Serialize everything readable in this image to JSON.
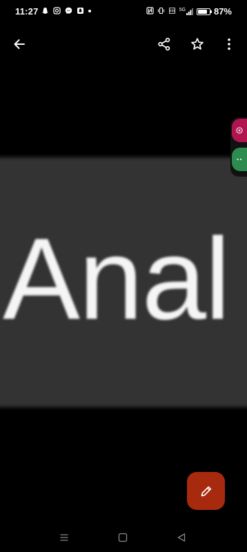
{
  "status_bar": {
    "time": "11:27",
    "notification_icons": [
      "snapchat-icon",
      "instagram-icon",
      "messenger-icon",
      "snapchat-icon",
      "dot-icon"
    ],
    "system_icons": [
      "nfc-icon",
      "vibrate-icon",
      "volte-icon",
      "signal-icon"
    ],
    "signal_label": "5G",
    "battery_level": 0.87,
    "battery_percent": "87%"
  },
  "toolbar": {
    "back_icon": "arrow-left-icon",
    "share_icon": "share-icon",
    "favorite_icon": "star-outline-icon",
    "more_icon": "more-vertical-icon"
  },
  "image_viewer": {
    "text": "Anal"
  },
  "side_bubbles": [
    {
      "icon": "chat-head-icon",
      "color": "#b0154f"
    },
    {
      "icon": "chat-head-icon",
      "color": "#2e8b4f"
    }
  ],
  "fab": {
    "icon": "pencil-icon",
    "color": "#a82a0e"
  },
  "nav_bar": {
    "recents_icon": "menu-lines-icon",
    "home_icon": "square-icon",
    "back_icon": "triangle-back-icon"
  },
  "colors": {
    "background": "#000000",
    "image_pill": "#333333",
    "fab": "#a82a0e"
  }
}
